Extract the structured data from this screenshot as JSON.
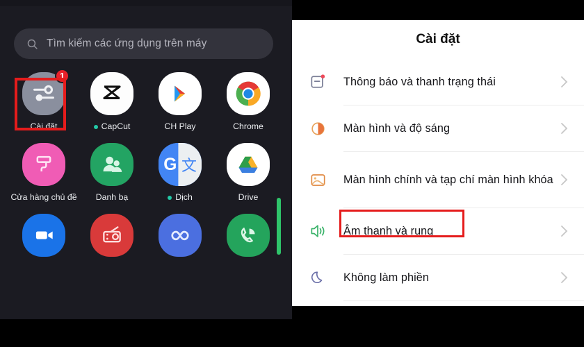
{
  "left_panel": {
    "name": "app-drawer",
    "search": {
      "placeholder": "Tìm kiếm các ứng dụng trên máy",
      "icon": "search-icon"
    },
    "app_rows": [
      [
        {
          "label": "Cài đặt",
          "icon": "settings-sliders-icon",
          "badge": "1",
          "new": false,
          "highlighted": true
        },
        {
          "label": "CapCut",
          "icon": "capcut-icon",
          "badge": "",
          "new": true,
          "highlighted": false
        },
        {
          "label": "CH Play",
          "icon": "google-play-icon",
          "badge": "",
          "new": false,
          "highlighted": false
        },
        {
          "label": "Chrome",
          "icon": "chrome-icon",
          "badge": "",
          "new": false,
          "highlighted": false
        }
      ],
      [
        {
          "label": "Cửa hàng chủ đề",
          "icon": "theme-store-icon",
          "badge": "",
          "new": false,
          "highlighted": false
        },
        {
          "label": "Danh bạ",
          "icon": "contacts-icon",
          "badge": "",
          "new": false,
          "highlighted": false
        },
        {
          "label": "Dịch",
          "icon": "google-translate-icon",
          "badge": "",
          "new": true,
          "highlighted": false
        },
        {
          "label": "Drive",
          "icon": "google-drive-icon",
          "badge": "",
          "new": false,
          "highlighted": false
        }
      ],
      [
        {
          "label": "",
          "icon": "video-camera-icon",
          "badge": "",
          "new": false,
          "highlighted": false
        },
        {
          "label": "",
          "icon": "radio-icon",
          "badge": "",
          "new": false,
          "highlighted": false
        },
        {
          "label": "",
          "icon": "infinity-loop-icon",
          "badge": "",
          "new": false,
          "highlighted": false
        },
        {
          "label": "",
          "icon": "phone-icon",
          "badge": "",
          "new": false,
          "highlighted": false
        }
      ]
    ],
    "scrollbar_color": "#2fc46a"
  },
  "right_panel": {
    "title": "Cài đặt",
    "items": [
      {
        "label": "Thông báo và thanh trạng thái",
        "icon": "notification-icon",
        "highlighted": false
      },
      {
        "label": "Màn hình và độ sáng",
        "icon": "brightness-icon",
        "highlighted": false
      },
      {
        "label": "Màn hình chính và tạp chí màn hình khóa",
        "icon": "wallpaper-icon",
        "highlighted": false
      },
      {
        "label": "Âm thanh và rung",
        "icon": "sound-volume-icon",
        "highlighted": true
      },
      {
        "label": "Không làm phiền",
        "icon": "moon-icon",
        "highlighted": false
      }
    ],
    "chevron_icon": "chevron-right-icon"
  },
  "annotations": {
    "highlight_color": "#e51c1c"
  }
}
